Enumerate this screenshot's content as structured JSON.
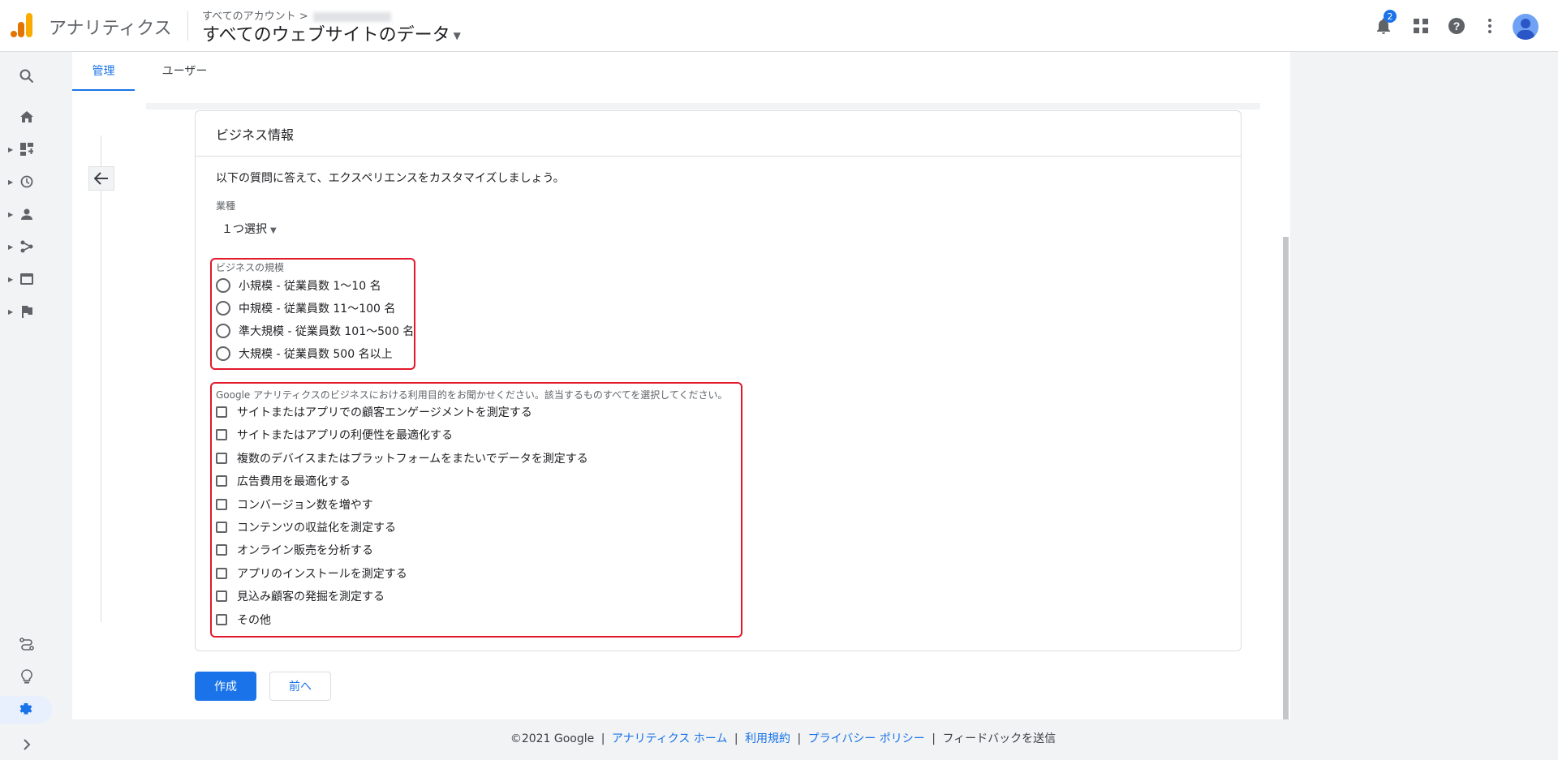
{
  "header": {
    "product_name": "アナリティクス",
    "account_crumb": "すべてのアカウント >",
    "property_name": "すべてのウェブサイトのデータ",
    "notification_count": "2",
    "brand_color": "#f9ab00"
  },
  "sidebar": {
    "items": [
      {
        "name": "search-icon"
      },
      {
        "name": "home-icon"
      },
      {
        "name": "customization-icon"
      },
      {
        "name": "realtime-icon"
      },
      {
        "name": "audience-icon"
      },
      {
        "name": "acquisition-icon"
      },
      {
        "name": "behavior-icon"
      },
      {
        "name": "conversions-icon"
      },
      {
        "name": "attribution-icon"
      },
      {
        "name": "discover-icon"
      },
      {
        "name": "admin-gear-icon"
      },
      {
        "name": "expand-icon"
      }
    ]
  },
  "tabs": [
    {
      "label": "管理",
      "active": true
    },
    {
      "label": "ユーザー",
      "active": false
    }
  ],
  "card": {
    "title": "ビジネス情報",
    "intro": "以下の質問に答えて、エクスペリエンスをカスタマイズしましょう。",
    "industry_label": "業種",
    "industry_value": "１つ選択",
    "size_label": "ビジネスの規模",
    "size_options": [
      "小規模 - 従業員数 1〜10 名",
      "中規模 - 従業員数 11〜100 名",
      "準大規模 - 従業員数 101〜500 名",
      "大規模 - 従業員数 500 名以上"
    ],
    "usage_label": "Google アナリティクスのビジネスにおける利用目的をお聞かせください。該当するものすべてを選択してください。",
    "usage_options": [
      "サイトまたはアプリでの顧客エンゲージメントを測定する",
      "サイトまたはアプリの利便性を最適化する",
      "複数のデバイスまたはプラットフォームをまたいでデータを測定する",
      "広告費用を最適化する",
      "コンバージョン数を増やす",
      "コンテンツの収益化を測定する",
      "オンライン販売を分析する",
      "アプリのインストールを測定する",
      "見込み顧客の発掘を測定する",
      "その他"
    ]
  },
  "buttons": {
    "create": "作成",
    "back": "前へ"
  },
  "footer": {
    "copyright": "©2021 Google",
    "links": [
      "アナリティクス ホーム",
      "利用規約",
      "プライバシー ポリシー"
    ],
    "feedback": "フィードバックを送信"
  },
  "colors": {
    "accent": "#1a73e8",
    "highlight_box": "#e3182b"
  }
}
